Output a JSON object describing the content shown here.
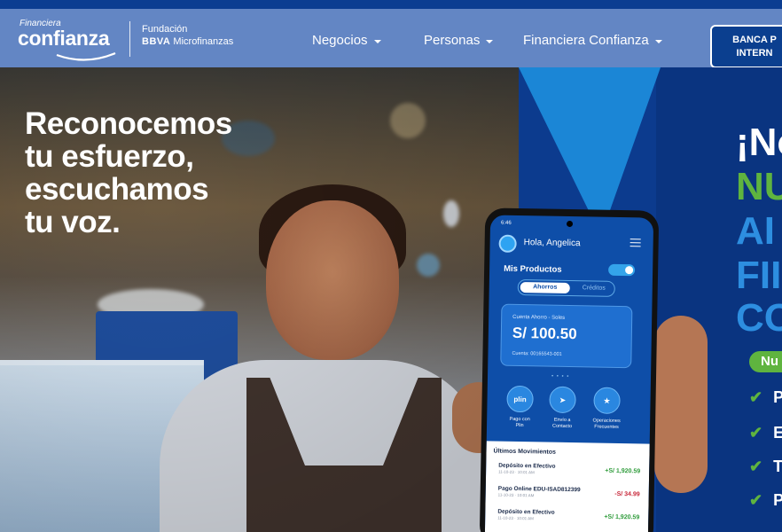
{
  "header": {
    "logo": {
      "small": "Financiera",
      "big": "confianza",
      "fund_line1": "Fundación",
      "fund_bbva": "BBVA",
      "fund_rest": "Microfinanzas"
    },
    "nav": [
      {
        "label": "Negocios"
      },
      {
        "label": "Personas"
      },
      {
        "label": "Financiera Confianza"
      }
    ],
    "banca_button": {
      "line1": "BANCA P",
      "line2": "INTERN"
    }
  },
  "hero": {
    "headline": [
      "Reconocemos",
      "tu esfuerzo,",
      "escuchamos",
      "tu voz."
    ],
    "promo_lines": [
      {
        "text": "¡No",
        "color": "#ffffff"
      },
      {
        "text": "NU",
        "color": "#5fb43f"
      },
      {
        "text": "AI",
        "color": "#2d8ee0"
      },
      {
        "text": "FII",
        "color": "#2d8ee0"
      },
      {
        "text": "CO",
        "color": "#2d8ee0"
      }
    ],
    "promo_pill": "Nu",
    "checklist": [
      "Pl",
      "Er",
      "Tr",
      "P"
    ]
  },
  "phone": {
    "time": "6:46",
    "greeting": "Hola, Angelica",
    "products_title": "Mis Productos",
    "tabs": {
      "active": "Ahorros",
      "inactive": "Créditos"
    },
    "account": {
      "type": "Cuenta Ahorro - Soles",
      "balance": "S/ 100.50",
      "number": "Cuenta: 00165543-001"
    },
    "carousel_dots": "• • • •",
    "quick_actions": [
      {
        "icon": "plin-icon",
        "glyph": "plin",
        "label1": "Pago con",
        "label2": "Plin"
      },
      {
        "icon": "send-icon",
        "glyph": "➤",
        "label1": "Envío a",
        "label2": "Contacto"
      },
      {
        "icon": "star-icon",
        "glyph": "★",
        "label1": "Operaciones",
        "label2": "Frecuentes"
      }
    ],
    "movements_title": "Últimos Movimientos",
    "movements": [
      {
        "name": "Depósito en Efectivo",
        "date": "11-10-23 · 10:01 AM",
        "amount": "+S/ 1,920.59",
        "color": "#2e9b3a"
      },
      {
        "name": "Pago Online EDU-ISAD812399",
        "date": "11-10-23 · 10:01 AM",
        "amount": "-S/ 34.99",
        "color": "#c8283a"
      },
      {
        "name": "Depósito en Efectivo",
        "date": "11-10-23 · 10:01 AM",
        "amount": "+S/ 1,920.59",
        "color": "#2e9b3a"
      }
    ]
  },
  "colors": {
    "nav_bg": "#6386c4",
    "top_strip": "#0b3d91",
    "brand_blue": "#0c3b8e",
    "brand_green": "#5fb43f",
    "light_blue": "#1b86d6"
  }
}
